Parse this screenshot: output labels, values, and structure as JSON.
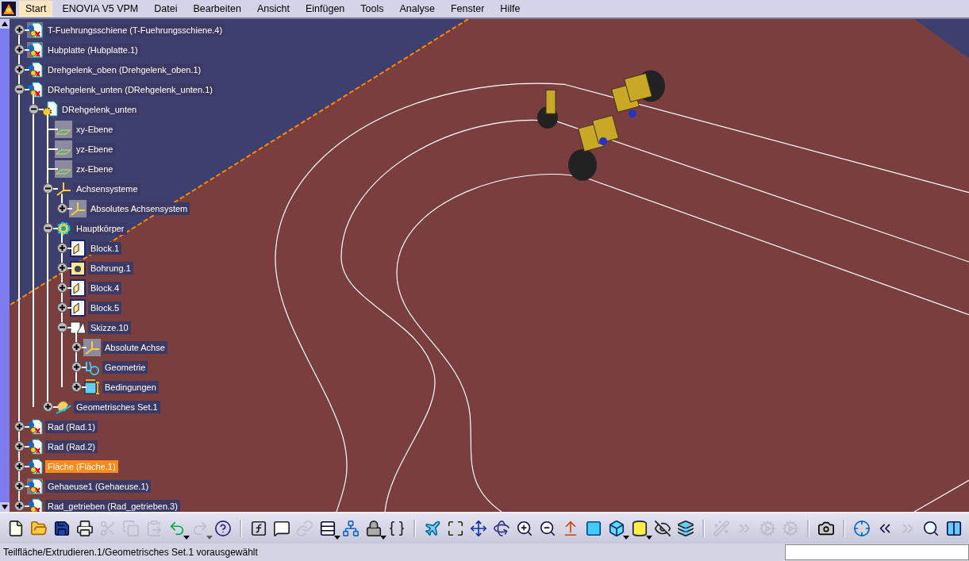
{
  "menu": [
    {
      "label": "Start",
      "selected": true
    },
    {
      "label": "ENOVIA V5 VPM",
      "selected": false
    },
    {
      "label": "Datei",
      "selected": false
    },
    {
      "label": "Bearbeiten",
      "selected": false
    },
    {
      "label": "Ansicht",
      "selected": false
    },
    {
      "label": "Einfügen",
      "selected": false
    },
    {
      "label": "Tools",
      "selected": false
    },
    {
      "label": "Analyse",
      "selected": false
    },
    {
      "label": "Fenster",
      "selected": false
    },
    {
      "label": "Hilfe",
      "selected": false
    }
  ],
  "tree": [
    {
      "label": "T-Fuehrungsschiene (T-Fuehrungsschiene.4)",
      "kind": "product-hidden",
      "expanded": false,
      "selected": false
    },
    {
      "label": "Hubplatte (Hubplatte.1)",
      "kind": "product-hidden",
      "expanded": false,
      "selected": false
    },
    {
      "label": "Drehgelenk_oben (Drehgelenk_oben.1)",
      "kind": "product",
      "expanded": false,
      "selected": false
    },
    {
      "label": "DRehgelenk_unten (DRehgelenk_unten.1)",
      "kind": "product",
      "expanded": true,
      "selected": false,
      "children": [
        {
          "label": "DRehgelenk_unten",
          "kind": "part",
          "expanded": true,
          "selected": false,
          "children": [
            {
              "label": "xy-Ebene",
              "kind": "plane",
              "selected": false
            },
            {
              "label": "yz-Ebene",
              "kind": "plane",
              "selected": false
            },
            {
              "label": "zx-Ebene",
              "kind": "plane",
              "selected": false
            },
            {
              "label": "Achsensysteme",
              "kind": "axes",
              "expanded": true,
              "selected": false,
              "children": [
                {
                  "label": "Absolutes Achsensystem",
                  "kind": "axes-hidden",
                  "expanded": false,
                  "selected": false
                }
              ]
            },
            {
              "label": "Hauptkörper",
              "kind": "body",
              "expanded": true,
              "selected": false,
              "children": [
                {
                  "label": "Block.1",
                  "kind": "block",
                  "expanded": false,
                  "selected": false
                },
                {
                  "label": "Bohrung.1",
                  "kind": "hole",
                  "expanded": false,
                  "selected": false
                },
                {
                  "label": "Block.4",
                  "kind": "block",
                  "expanded": false,
                  "selected": false
                },
                {
                  "label": "Block.5",
                  "kind": "block",
                  "expanded": false,
                  "selected": false
                },
                {
                  "label": "Skizze.10",
                  "kind": "sketch",
                  "expanded": true,
                  "selected": false,
                  "children": [
                    {
                      "label": "Absolute Achse",
                      "kind": "axes-hidden",
                      "expanded": false,
                      "selected": false
                    },
                    {
                      "label": "Geometrie",
                      "kind": "geometry",
                      "expanded": false,
                      "selected": false
                    },
                    {
                      "label": "Bedingungen",
                      "kind": "constraints",
                      "expanded": false,
                      "selected": false
                    }
                  ]
                }
              ]
            },
            {
              "label": "Geometrisches Set.1",
              "kind": "geoset",
              "expanded": false,
              "selected": false
            }
          ]
        }
      ]
    },
    {
      "label": "Rad (Rad.1)",
      "kind": "product",
      "expanded": false,
      "selected": false
    },
    {
      "label": "Rad (Rad.2)",
      "kind": "product",
      "expanded": false,
      "selected": false
    },
    {
      "label": "Fläche (Fläche.1)",
      "kind": "product",
      "expanded": false,
      "selected": true
    },
    {
      "label": "Gehaeuse1 (Gehaeuse.1)",
      "kind": "product-hidden",
      "expanded": false,
      "selected": false
    },
    {
      "label": "Rad_getrieben (Rad_getrieben.3)",
      "kind": "product",
      "expanded": false,
      "selected": false
    }
  ],
  "toolbar": [
    {
      "kind": "new",
      "disabled": false,
      "dropdown": false
    },
    {
      "kind": "open",
      "disabled": false,
      "dropdown": false
    },
    {
      "kind": "save",
      "disabled": false,
      "dropdown": false
    },
    {
      "kind": "print",
      "disabled": false,
      "dropdown": false
    },
    {
      "kind": "cut",
      "disabled": true,
      "dropdown": false
    },
    {
      "kind": "copy",
      "disabled": true,
      "dropdown": false
    },
    {
      "kind": "paste",
      "disabled": true,
      "dropdown": false
    },
    {
      "kind": "undo",
      "disabled": false,
      "dropdown": true
    },
    {
      "kind": "redo",
      "disabled": true,
      "dropdown": true
    },
    {
      "kind": "help",
      "disabled": false,
      "dropdown": false
    },
    {
      "kind": "separator"
    },
    {
      "kind": "formula",
      "disabled": false,
      "dropdown": false
    },
    {
      "kind": "comment",
      "disabled": false,
      "dropdown": false
    },
    {
      "kind": "link",
      "disabled": true,
      "dropdown": false
    },
    {
      "kind": "table",
      "disabled": false,
      "dropdown": true
    },
    {
      "kind": "graph",
      "disabled": false,
      "dropdown": false
    },
    {
      "kind": "lock",
      "disabled": false,
      "dropdown": true
    },
    {
      "kind": "parameter",
      "disabled": false,
      "dropdown": false
    },
    {
      "kind": "separator"
    },
    {
      "kind": "fly",
      "disabled": false,
      "dropdown": false
    },
    {
      "kind": "fit",
      "disabled": false,
      "dropdown": false
    },
    {
      "kind": "pan",
      "disabled": false,
      "dropdown": false
    },
    {
      "kind": "rotate",
      "disabled": false,
      "dropdown": false
    },
    {
      "kind": "zoom-in",
      "disabled": false,
      "dropdown": false
    },
    {
      "kind": "zoom-out",
      "disabled": false,
      "dropdown": false
    },
    {
      "kind": "normal",
      "disabled": false,
      "dropdown": false
    },
    {
      "kind": "multi-view",
      "disabled": false,
      "dropdown": false
    },
    {
      "kind": "iso",
      "disabled": false,
      "dropdown": true
    },
    {
      "kind": "shading",
      "disabled": false,
      "dropdown": true
    },
    {
      "kind": "hide",
      "disabled": false,
      "dropdown": false
    },
    {
      "kind": "swap",
      "disabled": false,
      "dropdown": false
    },
    {
      "kind": "separator"
    },
    {
      "kind": "wand",
      "disabled": true,
      "dropdown": false
    },
    {
      "kind": "next",
      "disabled": true,
      "dropdown": false
    },
    {
      "kind": "settings",
      "disabled": true,
      "dropdown": false
    },
    {
      "kind": "settings",
      "disabled": true,
      "dropdown": false
    },
    {
      "kind": "separator"
    },
    {
      "kind": "camera",
      "disabled": false,
      "dropdown": false
    },
    {
      "kind": "separator"
    },
    {
      "kind": "target",
      "disabled": false,
      "dropdown": false
    },
    {
      "kind": "previous",
      "disabled": false,
      "dropdown": false
    },
    {
      "kind": "next",
      "disabled": true,
      "dropdown": false
    },
    {
      "kind": "search",
      "disabled": false,
      "dropdown": false
    },
    {
      "kind": "columns",
      "disabled": false,
      "dropdown": false
    }
  ],
  "status_bar": {
    "text": "Teilfläche/Extrudieren.1/Geometrisches Set.1 vorausgewählt"
  }
}
